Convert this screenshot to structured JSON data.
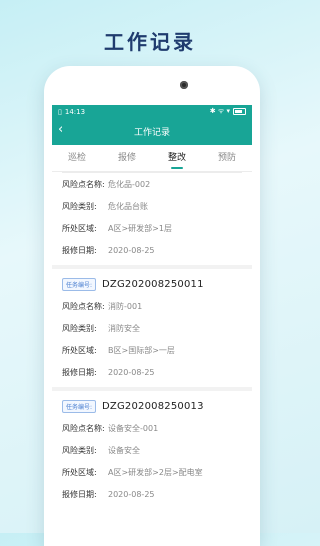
{
  "headline": "工作记录",
  "status_bar": {
    "time": "14:13",
    "icons": "✱ ᯤ ▾"
  },
  "nav": {
    "back_icon": "‹",
    "title": "工作记录"
  },
  "tabs": [
    {
      "label": "巡检",
      "active": false
    },
    {
      "label": "报修",
      "active": false
    },
    {
      "label": "整改",
      "active": true
    },
    {
      "label": "预防",
      "active": false
    }
  ],
  "labels": {
    "risk_name": "风险点名称:",
    "risk_type": "风险类别:",
    "area": "所处区域:",
    "date": "报修日期:",
    "task_tag": "任务编号:"
  },
  "records": [
    {
      "task_no": "",
      "risk_name": "危化品-002",
      "risk_type": "危化品台账",
      "area": "A区>研发部>1层",
      "date": "2020-08-25"
    },
    {
      "task_no": "DZG202008250011",
      "risk_name": "消防-001",
      "risk_type": "消防安全",
      "area": "B区>国际部>一层",
      "date": "2020-08-25"
    },
    {
      "task_no": "DZG202008250013",
      "risk_name": "设备安全-001",
      "risk_type": "设备安全",
      "area": "A区>研发部>2层>配电室",
      "date": "2020-08-25"
    }
  ]
}
